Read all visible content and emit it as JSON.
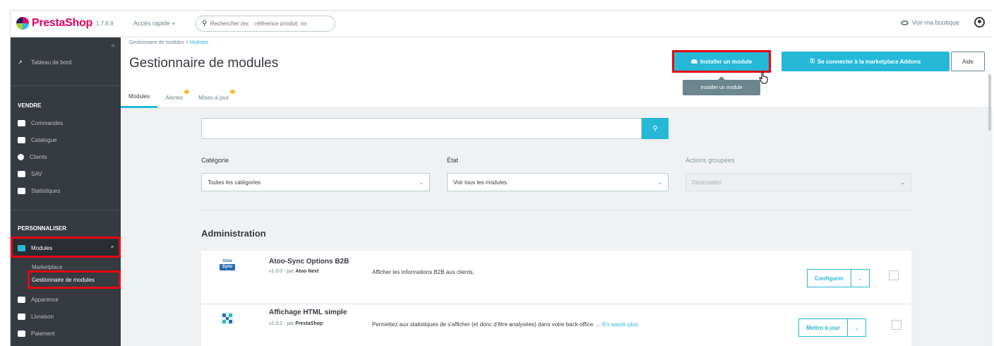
{
  "header": {
    "logo_text": "PrestaShop",
    "version": "1.7.8.8",
    "quick_access": "Accès rapide",
    "search_placeholder": "Rechercher (ex. : référence produit, no",
    "view_shop": "Voir ma boutique"
  },
  "sidebar": {
    "dashboard": "Tableau de bord",
    "section_sell": "VENDRE",
    "sell_items": [
      "Commandes",
      "Catalogue",
      "Clients",
      "SAV",
      "Statistiques"
    ],
    "section_customize": "PERSONNALISER",
    "modules": "Modules",
    "modules_sub": [
      "Marketplace",
      "Gestionnaire de modules"
    ],
    "more_items": [
      "Apparence",
      "Livraison",
      "Paiement"
    ]
  },
  "page": {
    "breadcrumb_root": "Gestionnaire de modules",
    "breadcrumb_sep": ">",
    "breadcrumb_current": "Modules",
    "title": "Gestionnaire de modules",
    "install_button": "Installer un module",
    "connect_button": "Se connecter à la marketplace Addons",
    "help_button": "Aide",
    "tooltip": "Installer un module",
    "tabs": [
      "Modules",
      "Alertes",
      "Mises à jour"
    ]
  },
  "filters": {
    "category_label": "Catégorie",
    "category_value": "Toutes les catégories",
    "state_label": "État",
    "state_value": "Voir tous les modules",
    "bulk_label": "Actions groupées",
    "bulk_value": "Désinstaller"
  },
  "section": {
    "title": "Administration"
  },
  "modules": [
    {
      "logo_line1": "Atoo",
      "logo_line2": "Sync",
      "name": "Atoo-Sync Options B2B",
      "version": "v1.0.0 - par",
      "author": "Atoo Next",
      "description": "Afficher les informations B2B aux clients.",
      "more": "",
      "action": "Configurer"
    },
    {
      "logo_line1": "",
      "logo_line2": "",
      "name": "Affichage HTML simple",
      "version": "v2.0.2 - par",
      "author": "PrestaShop",
      "description": "Permettez aux statistiques de s'afficher (et donc d'être analysées) dans votre back-office. ...",
      "more": "En savoir plus",
      "action": "Mettre à jour"
    }
  ],
  "colors": {
    "accent": "#25b9d7",
    "sidebar": "#363a41",
    "highlight": "#e30613",
    "brand": "#df0067"
  }
}
